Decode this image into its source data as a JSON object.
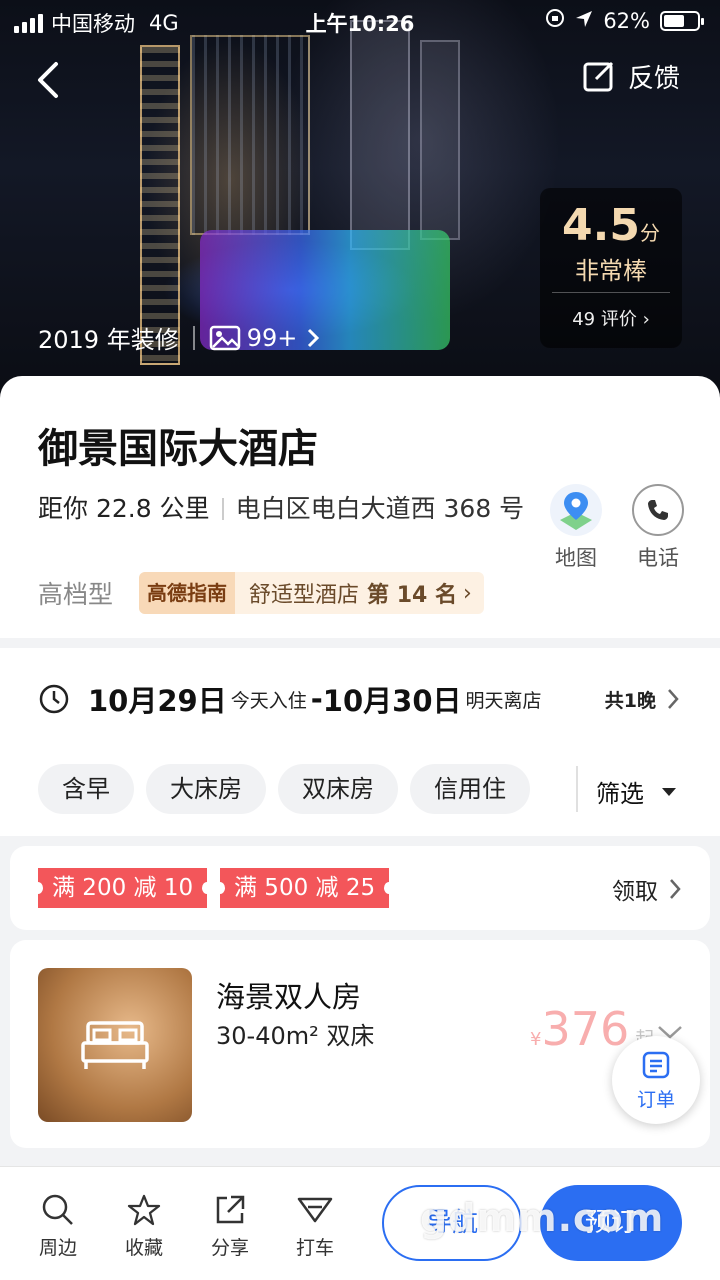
{
  "status_bar": {
    "carrier": "中国移动",
    "network": "4G",
    "time": "上午10:26",
    "battery": "62%",
    "battery_level": 0.62
  },
  "header": {
    "feedback_label": "反馈"
  },
  "hero": {
    "renovation": "2019 年装修",
    "photo_count": "99+",
    "rating_score": "4.5",
    "rating_unit": "分",
    "rating_word": "非常棒",
    "review_count": "49 评价"
  },
  "hotel": {
    "name": "御景国际大酒店",
    "distance": "距你 22.8 公里",
    "address": "电白区电白大道西 368 号",
    "grade": "高档型",
    "rank_brand": "高德指南",
    "rank_text": "舒适型酒店",
    "rank_position": "第 14 名",
    "map_label": "地图",
    "phone_label": "电话"
  },
  "stay": {
    "checkin_date": "10月29日",
    "checkin_note": "今天入住",
    "separator": "-",
    "checkout_date": "10月30日",
    "checkout_note": "明天离店",
    "nights": "共1晚"
  },
  "filters": {
    "chips": [
      "含早",
      "大床房",
      "双床房",
      "信用住"
    ],
    "filter_label": "筛选"
  },
  "coupons": {
    "items": [
      "满 200 减 10",
      "满 500 减 25"
    ],
    "claim_label": "领取"
  },
  "room": {
    "name": "海景双人房",
    "meta": "30-40m²  双床",
    "currency": "¥",
    "price": "376",
    "price_suffix": "起"
  },
  "order_fab": {
    "label": "订单"
  },
  "bottom_bar": {
    "tabs": [
      "周边",
      "收藏",
      "分享",
      "打车"
    ],
    "navigate_label": "导航",
    "book_label": "预订"
  },
  "watermark": "gdmm.com",
  "colors": {
    "accent": "#2b6ef2",
    "coupon": "#f3565a",
    "rating_gold": "#f4d9b0"
  }
}
